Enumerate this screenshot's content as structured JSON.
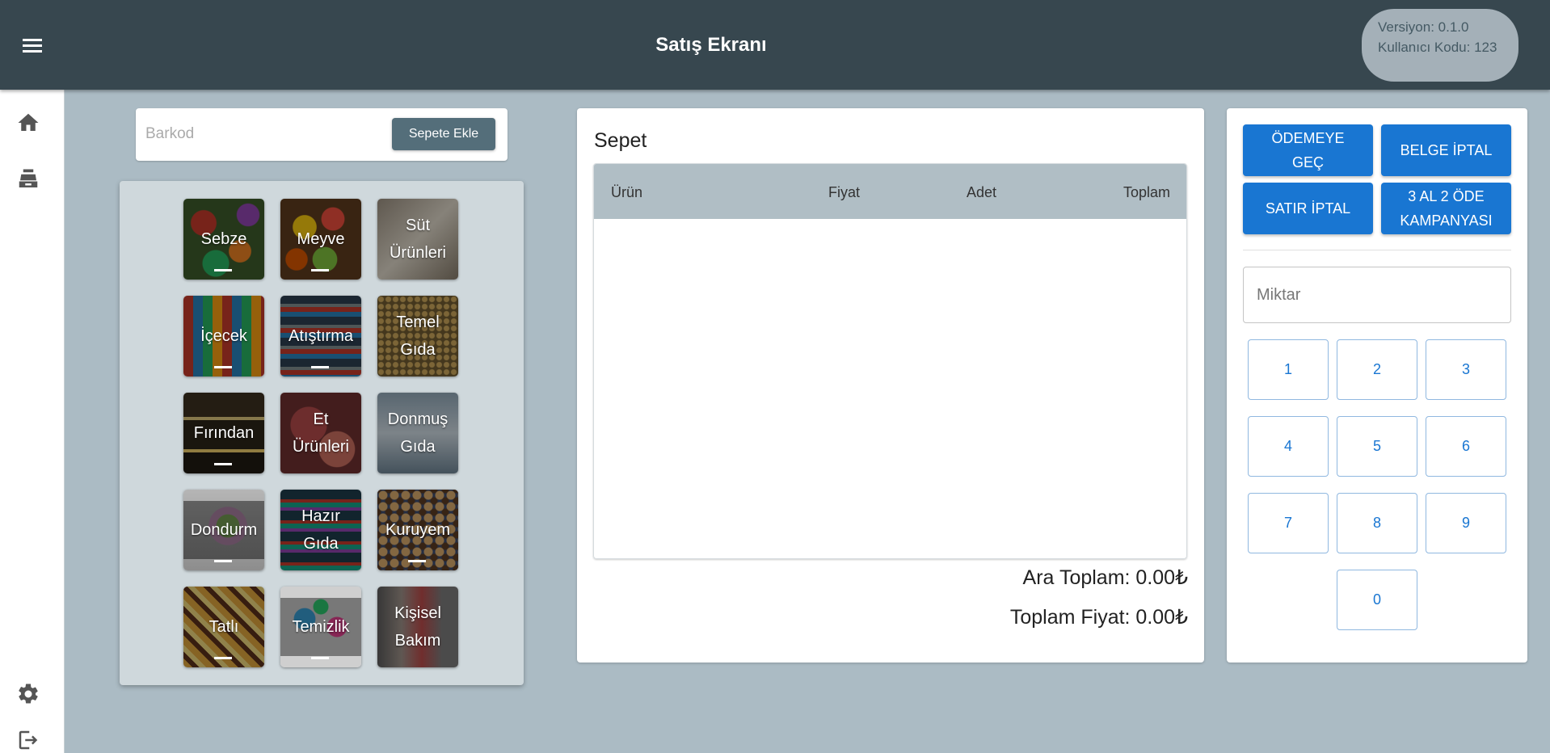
{
  "header": {
    "title": "Satış Ekranı",
    "version": "Versiyon: 0.1.0",
    "user_code": "Kullanıcı Kodu: 123",
    "menu_icon": "hamburger-menu-icon"
  },
  "sidebar": {
    "items": [
      {
        "icon": "home-icon"
      },
      {
        "icon": "cash-register-icon"
      },
      {
        "icon": "gear-icon"
      },
      {
        "icon": "logout-icon"
      }
    ]
  },
  "barcode": {
    "placeholder": "Barkod",
    "value": "",
    "button_label": "Sepete Ekle"
  },
  "categories": [
    {
      "label": "Sebze"
    },
    {
      "label": "Meyve"
    },
    {
      "label": "Süt\nÜrünleri"
    },
    {
      "label": "İçecek"
    },
    {
      "label": "Atıştırma"
    },
    {
      "label": "Temel\nGıda"
    },
    {
      "label": "Fırından"
    },
    {
      "label": "Et\nÜrünleri"
    },
    {
      "label": "Donmuş\nGıda"
    },
    {
      "label": "Dondurm"
    },
    {
      "label": "Hazır\nGıda"
    },
    {
      "label": "Kuruyem"
    },
    {
      "label": "Tatlı"
    },
    {
      "label": "Temizlik"
    },
    {
      "label": "Kişisel\nBakım"
    }
  ],
  "cart": {
    "title": "Sepet",
    "columns": [
      "Ürün",
      "Fiyat",
      "Adet",
      "Toplam"
    ],
    "rows": [],
    "subtotal": "Ara Toplam: 0.00₺",
    "total": "Toplam Fiyat: 0.00₺"
  },
  "actions": {
    "pay": "ÖDEMEYE\nGEÇ",
    "cancel_document": "BELGE İPTAL",
    "cancel_line": "SATIR İPTAL",
    "campaign": "3 AL 2 ÖDE\nKAMPANYASI"
  },
  "quantity": {
    "placeholder": "Miktar",
    "value": ""
  },
  "numpad": [
    "1",
    "2",
    "3",
    "4",
    "5",
    "6",
    "7",
    "8",
    "9",
    "0"
  ]
}
